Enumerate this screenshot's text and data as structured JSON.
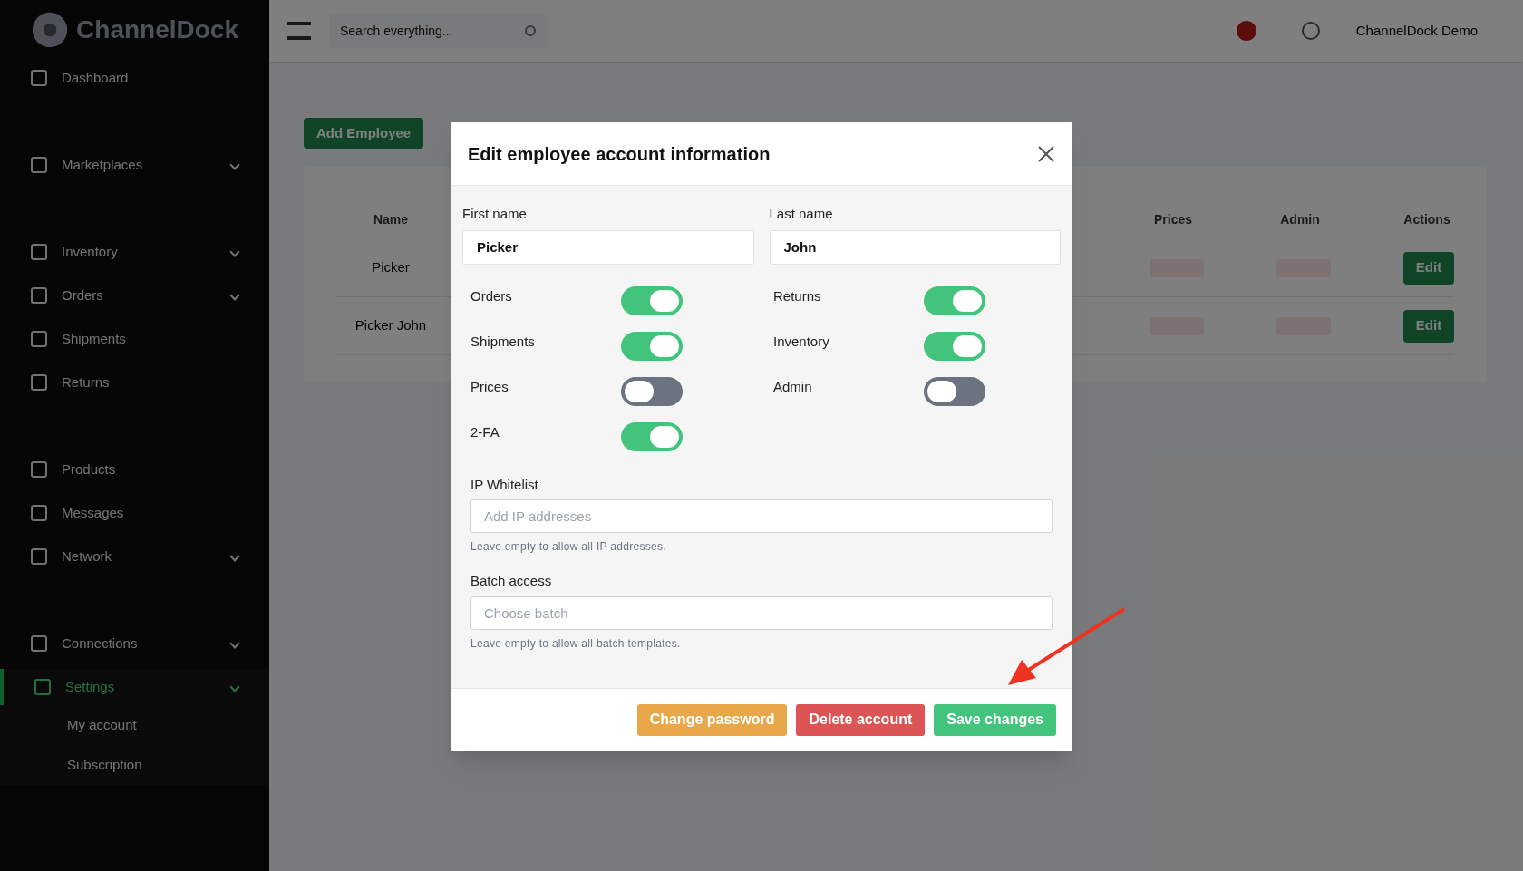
{
  "sidebar": {
    "logo": "ChannelDock",
    "sections": [
      {
        "items": [
          {
            "label": "Dashboard",
            "kind": "plain",
            "selected": false
          }
        ]
      },
      {
        "items": [
          {
            "label": "Marketplaces",
            "kind": "expandable",
            "selected": false
          }
        ]
      },
      {
        "items": [
          {
            "label": "Inventory",
            "kind": "expandable",
            "selected": false
          },
          {
            "label": "Orders",
            "kind": "expandable",
            "selected": false
          },
          {
            "label": "Shipments",
            "kind": "plain",
            "selected": false
          },
          {
            "label": "Returns",
            "kind": "plain",
            "selected": false
          }
        ]
      },
      {
        "items": [
          {
            "label": "Products",
            "kind": "plain",
            "selected": false
          },
          {
            "label": "Messages",
            "kind": "plain",
            "selected": false
          },
          {
            "label": "Network",
            "kind": "expandable",
            "selected": false
          }
        ]
      },
      {
        "items": [
          {
            "label": "Connections",
            "kind": "expandable",
            "selected": false
          },
          {
            "label": "Settings",
            "kind": "expandable",
            "selected": true,
            "children": [
              {
                "label": "My account"
              },
              {
                "label": "Subscription"
              }
            ]
          }
        ]
      }
    ]
  },
  "topbar": {
    "search": {
      "placeholder": "Search everything..."
    },
    "user": "ChannelDock Demo"
  },
  "page": {
    "add_button": "Add Employee",
    "table": {
      "columns": [
        "Name",
        "Prices",
        "Admin",
        "Actions"
      ],
      "rows": [
        {
          "name": "Picker",
          "action": "Edit"
        },
        {
          "name": "Picker John",
          "action": "Edit"
        }
      ]
    }
  },
  "dialog": {
    "title": "Edit employee account information",
    "fields": [
      {
        "label": "First name",
        "value": "Picker"
      },
      {
        "label": "Last name",
        "value": "John"
      }
    ],
    "toggles": [
      {
        "label": "Orders",
        "on": true
      },
      {
        "label": "Returns",
        "on": true
      },
      {
        "label": "Shipments",
        "on": true
      },
      {
        "label": "Inventory",
        "on": true
      },
      {
        "label": "Prices",
        "on": false
      },
      {
        "label": "Admin",
        "on": false
      },
      {
        "label": "2-FA",
        "on": true
      }
    ],
    "ip_whitelist": {
      "label": "IP Whitelist",
      "placeholder": "Add IP addresses",
      "hint": "Leave empty to allow all IP addresses."
    },
    "batch_access": {
      "label": "Batch access",
      "placeholder": "Choose batch",
      "hint": "Leave empty to allow all batch templates."
    },
    "buttons": [
      {
        "label": "Change password",
        "kind": "warning"
      },
      {
        "label": "Delete account",
        "kind": "danger"
      },
      {
        "label": "Save changes",
        "kind": "primary"
      }
    ]
  }
}
